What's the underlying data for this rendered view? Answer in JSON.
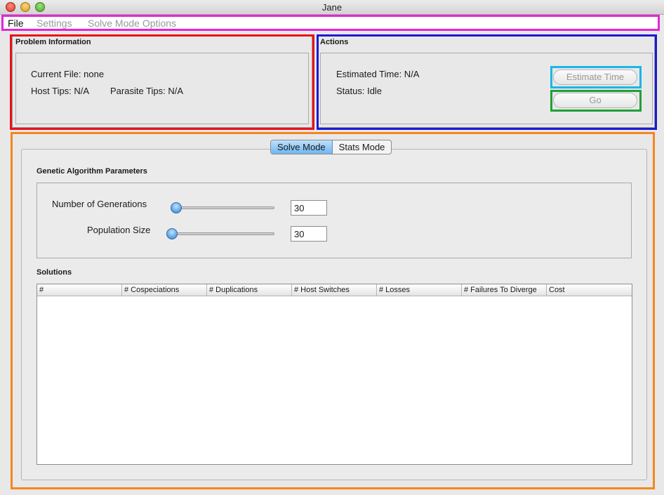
{
  "window": {
    "title": "Jane"
  },
  "menu": {
    "items": [
      "File",
      "Settings",
      "Solve Mode Options"
    ]
  },
  "problem_info": {
    "title": "Problem Information",
    "current_file": "Current File: none",
    "host_tips": "Host Tips: N/A",
    "parasite_tips": "Parasite Tips: N/A"
  },
  "actions": {
    "title": "Actions",
    "estimated_time": "Estimated Time: N/A",
    "status": "Status: Idle",
    "estimate_button": "Estimate Time",
    "go_button": "Go"
  },
  "tabs": {
    "solve": "Solve Mode",
    "stats": "Stats Mode",
    "active": "Solve Mode"
  },
  "ga_params": {
    "title": "Genetic Algorithm Parameters",
    "generations_label": "Number of Generations",
    "generations_value": "30",
    "population_label": "Population Size",
    "population_value": "30"
  },
  "solutions": {
    "title": "Solutions",
    "columns": [
      "#",
      "# Cospeciations",
      "# Duplications",
      "# Host Switches",
      "# Losses",
      "# Failures To Diverge",
      "Cost"
    ],
    "rows": []
  },
  "colors": {
    "menubar_highlight": "#e327d6",
    "problem_highlight": "#e8121b",
    "actions_highlight": "#1a1ad6",
    "estimate_highlight": "#1ab7e6",
    "go_highlight": "#21a038",
    "tabs_area_highlight": "#f5861f"
  }
}
